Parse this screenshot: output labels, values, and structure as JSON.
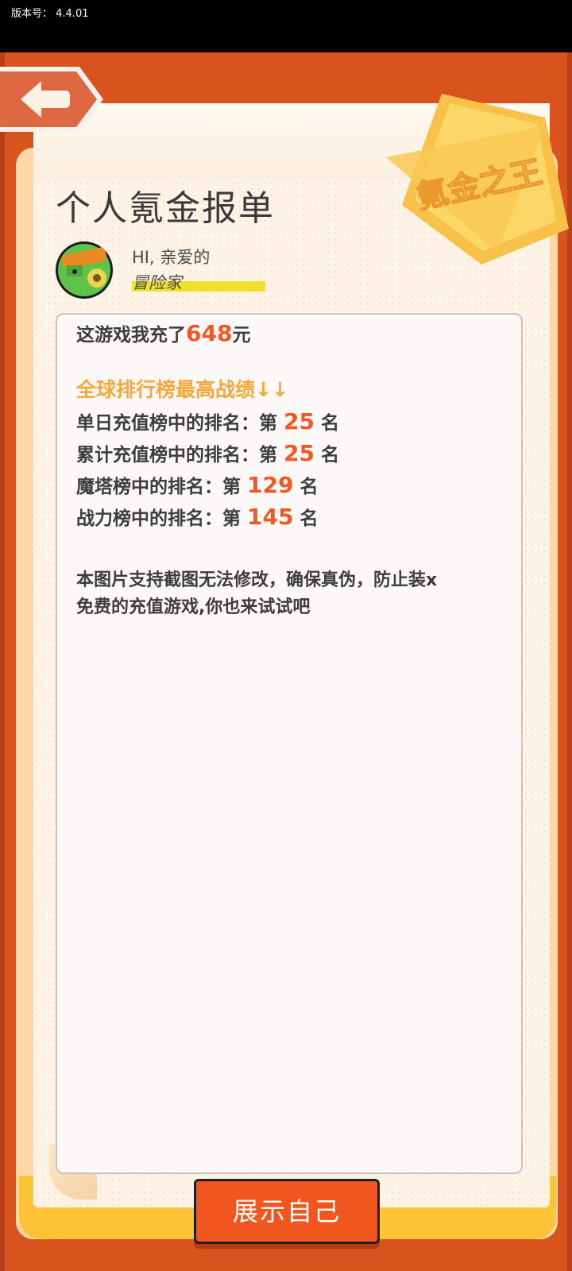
{
  "version_label": "版本号：  4.4.01",
  "colors": {
    "frame": "#d9531f",
    "accent_number": "#f05a22",
    "rank_title": "#f6a93a",
    "cta": "#f2561f",
    "highlight": "#f2e12b",
    "badge": "#fcd15a"
  },
  "badge_text": "氪金之王",
  "page_title": "个人氪金报单",
  "greeting": "HI, 亲爱的",
  "username": "冒险家",
  "report": {
    "paid_prefix": "这游戏我充了",
    "paid_amount": "648",
    "paid_suffix": "元",
    "rank_title": "全球排行榜最高战绩↓↓",
    "ranks": [
      {
        "label": "单日充值榜中的排名：第 ",
        "value": "25",
        "suffix": " 名"
      },
      {
        "label": "累计充值榜中的排名：第 ",
        "value": "25",
        "suffix": " 名"
      },
      {
        "label": "魔塔榜中的排名：第 ",
        "value": "129",
        "suffix": " 名"
      },
      {
        "label": "战力榜中的排名：第 ",
        "value": "145",
        "suffix": " 名"
      }
    ],
    "note_line1": "本图片支持截图无法修改，确保真伪，防止装x",
    "note_line2": "免费的充值游戏,你也来试试吧"
  },
  "cta_label": "展示自己",
  "icons": [
    "back-arrow-icon",
    "avatar-game-icon",
    "king-badge-icon"
  ]
}
